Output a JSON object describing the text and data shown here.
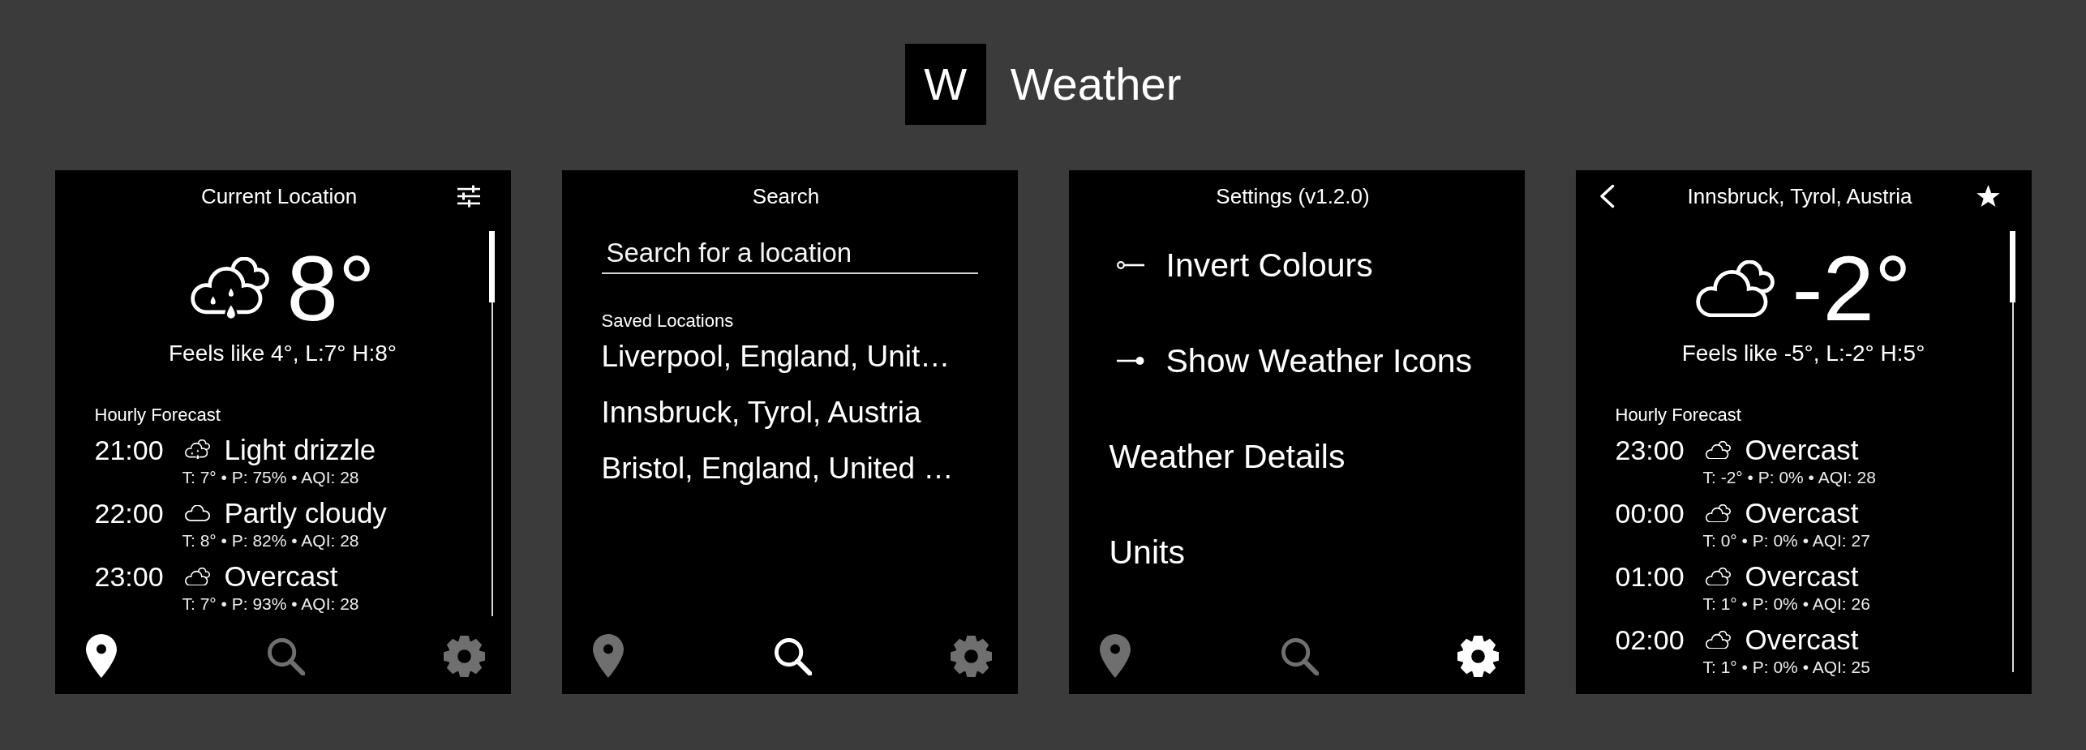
{
  "app": {
    "logo": "W",
    "title": "Weather"
  },
  "screens": [
    {
      "kind": "forecast",
      "title": "Current Location",
      "buttons": [
        {
          "kind": "adjust"
        }
      ],
      "now": {
        "kind": "drizzle",
        "temperature": "8°",
        "feels_like": "Feels like 4°, L:7° H:8°"
      },
      "hourly_heading": "Hourly Forecast",
      "hourly": [
        {
          "time": "21:00",
          "kind": "drizzle",
          "condition": "Light drizzle",
          "details": "T: 7° • P: 75% • AQI: 28"
        },
        {
          "time": "22:00",
          "kind": "cloud",
          "condition": "Partly cloudy",
          "details": "T: 8° • P: 82% • AQI: 28"
        },
        {
          "time": "23:00",
          "kind": "clouds",
          "condition": "Overcast",
          "details": "T: 7° • P: 93% • AQI: 28"
        }
      ],
      "nav": [
        {
          "kind": "location",
          "selected": true
        },
        {
          "kind": "search",
          "selected": false
        },
        {
          "kind": "settings",
          "selected": false
        }
      ]
    },
    {
      "kind": "search",
      "title": "Search",
      "search": {
        "placeholder": "Search for a location"
      },
      "saved_heading": "Saved Locations",
      "saved": [
        "Liverpool, England, Unit…",
        "Innsbruck, Tyrol, Austria",
        "Bristol, England, United …"
      ],
      "nav": [
        {
          "kind": "location",
          "selected": false
        },
        {
          "kind": "search",
          "selected": true
        },
        {
          "kind": "settings",
          "selected": false
        }
      ]
    },
    {
      "kind": "settings",
      "title": "Settings (v1.2.0)",
      "items": [
        {
          "kind": "toggle",
          "label": "Invert Colours",
          "on": false
        },
        {
          "kind": "toggle",
          "label": "Show Weather Icons",
          "on": true
        },
        {
          "kind": "link",
          "label": "Weather Details"
        },
        {
          "kind": "link",
          "label": "Units"
        }
      ],
      "nav": [
        {
          "kind": "location",
          "selected": false
        },
        {
          "kind": "search",
          "selected": false
        },
        {
          "kind": "settings",
          "selected": true
        }
      ]
    },
    {
      "kind": "forecast",
      "title": "Innsbruck, Tyrol, Austria",
      "buttons": [
        {
          "kind": "back"
        },
        {
          "kind": "favorite",
          "on": true
        }
      ],
      "now": {
        "kind": "clouds",
        "temperature": "-2°",
        "feels_like": "Feels like -5°, L:-2° H:5°"
      },
      "hourly_heading": "Hourly Forecast",
      "hourly": [
        {
          "time": "23:00",
          "kind": "clouds",
          "condition": "Overcast",
          "details": "T: -2° • P: 0% • AQI: 28"
        },
        {
          "time": "00:00",
          "kind": "clouds",
          "condition": "Overcast",
          "details": "T: 0° • P: 0% • AQI: 27"
        },
        {
          "time": "01:00",
          "kind": "clouds",
          "condition": "Overcast",
          "details": "T: 1° • P: 0% • AQI: 26"
        },
        {
          "time": "02:00",
          "kind": "clouds",
          "condition": "Overcast",
          "details": "T: 1° • P: 0% • AQI: 25"
        }
      ]
    }
  ]
}
